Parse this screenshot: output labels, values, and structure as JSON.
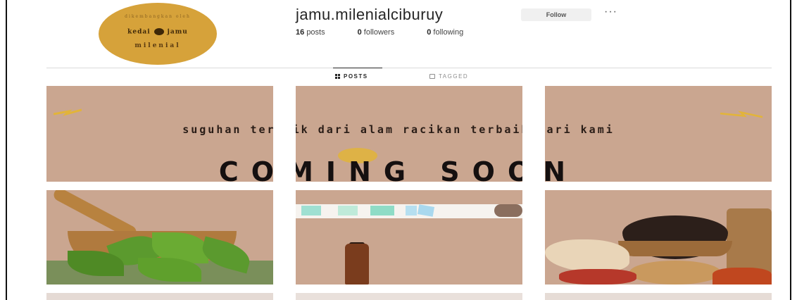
{
  "profile": {
    "username": "jamu.milenialciburuy",
    "follow_label": "Follow",
    "more_label": "···",
    "stats": [
      {
        "count": "16",
        "label": "posts"
      },
      {
        "count": "0",
        "label": "followers"
      },
      {
        "count": "0",
        "label": "following"
      }
    ],
    "avatar": {
      "top_text": "dikembangkan oleh",
      "left_word": "kedai",
      "right_word": "jamu",
      "bottom_word": "milenial"
    }
  },
  "tabs": [
    {
      "label": "POSTS",
      "icon": "grid-icon",
      "active": true
    },
    {
      "label": "TAGGED",
      "icon": "tag-icon",
      "active": false
    }
  ],
  "banner": {
    "tagline": "suguhan terbaik dari alam racikan terbaik dari kami",
    "title": "COMING SOON"
  },
  "colors": {
    "post_bg": "#caa690",
    "avatar": "#d6a23a",
    "accent_gold": "#e2b43a"
  }
}
